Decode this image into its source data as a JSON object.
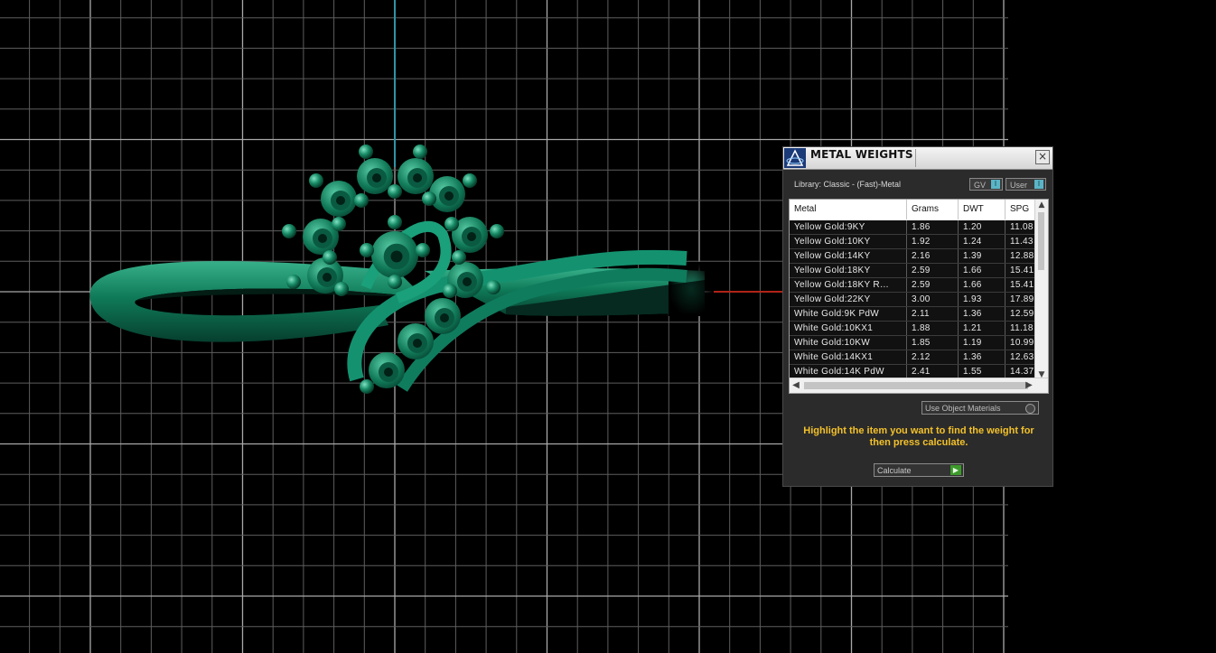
{
  "panel": {
    "title": "METAL WEIGHTS",
    "close_icon": "×",
    "library_label": "Library: Classic - (Fast)-Metal",
    "gv_label": "GV",
    "user_label": "User",
    "toggle_knob": "I",
    "table": {
      "headers": [
        "Metal",
        "Grams",
        "DWT",
        "SPG"
      ],
      "rows": [
        [
          "Yellow Gold:9KY",
          "1.86",
          "1.20",
          "11.08"
        ],
        [
          "Yellow Gold:10KY",
          "1.92",
          "1.24",
          "11.43"
        ],
        [
          "Yellow Gold:14KY",
          "2.16",
          "1.39",
          "12.88"
        ],
        [
          "Yellow Gold:18KY",
          "2.59",
          "1.66",
          "15.41"
        ],
        [
          "Yellow Gold:18KY R…",
          "2.59",
          "1.66",
          "15.41"
        ],
        [
          "Yellow Gold:22KY",
          "3.00",
          "1.93",
          "17.89"
        ],
        [
          "White Gold:9K PdW",
          "2.11",
          "1.36",
          "12.59"
        ],
        [
          "White Gold:10KX1",
          "1.88",
          "1.21",
          "11.18"
        ],
        [
          "White Gold:10KW",
          "1.85",
          "1.19",
          "10.99"
        ],
        [
          "White Gold:14KX1",
          "2.12",
          "1.36",
          "12.63"
        ],
        [
          "White Gold:14K PdW",
          "2.41",
          "1.55",
          "14.37"
        ]
      ]
    },
    "use_object_materials": "Use Object Materials",
    "hint": "Highlight the item you want to find the weight for then press calculate.",
    "calculate_label": "Calculate"
  }
}
